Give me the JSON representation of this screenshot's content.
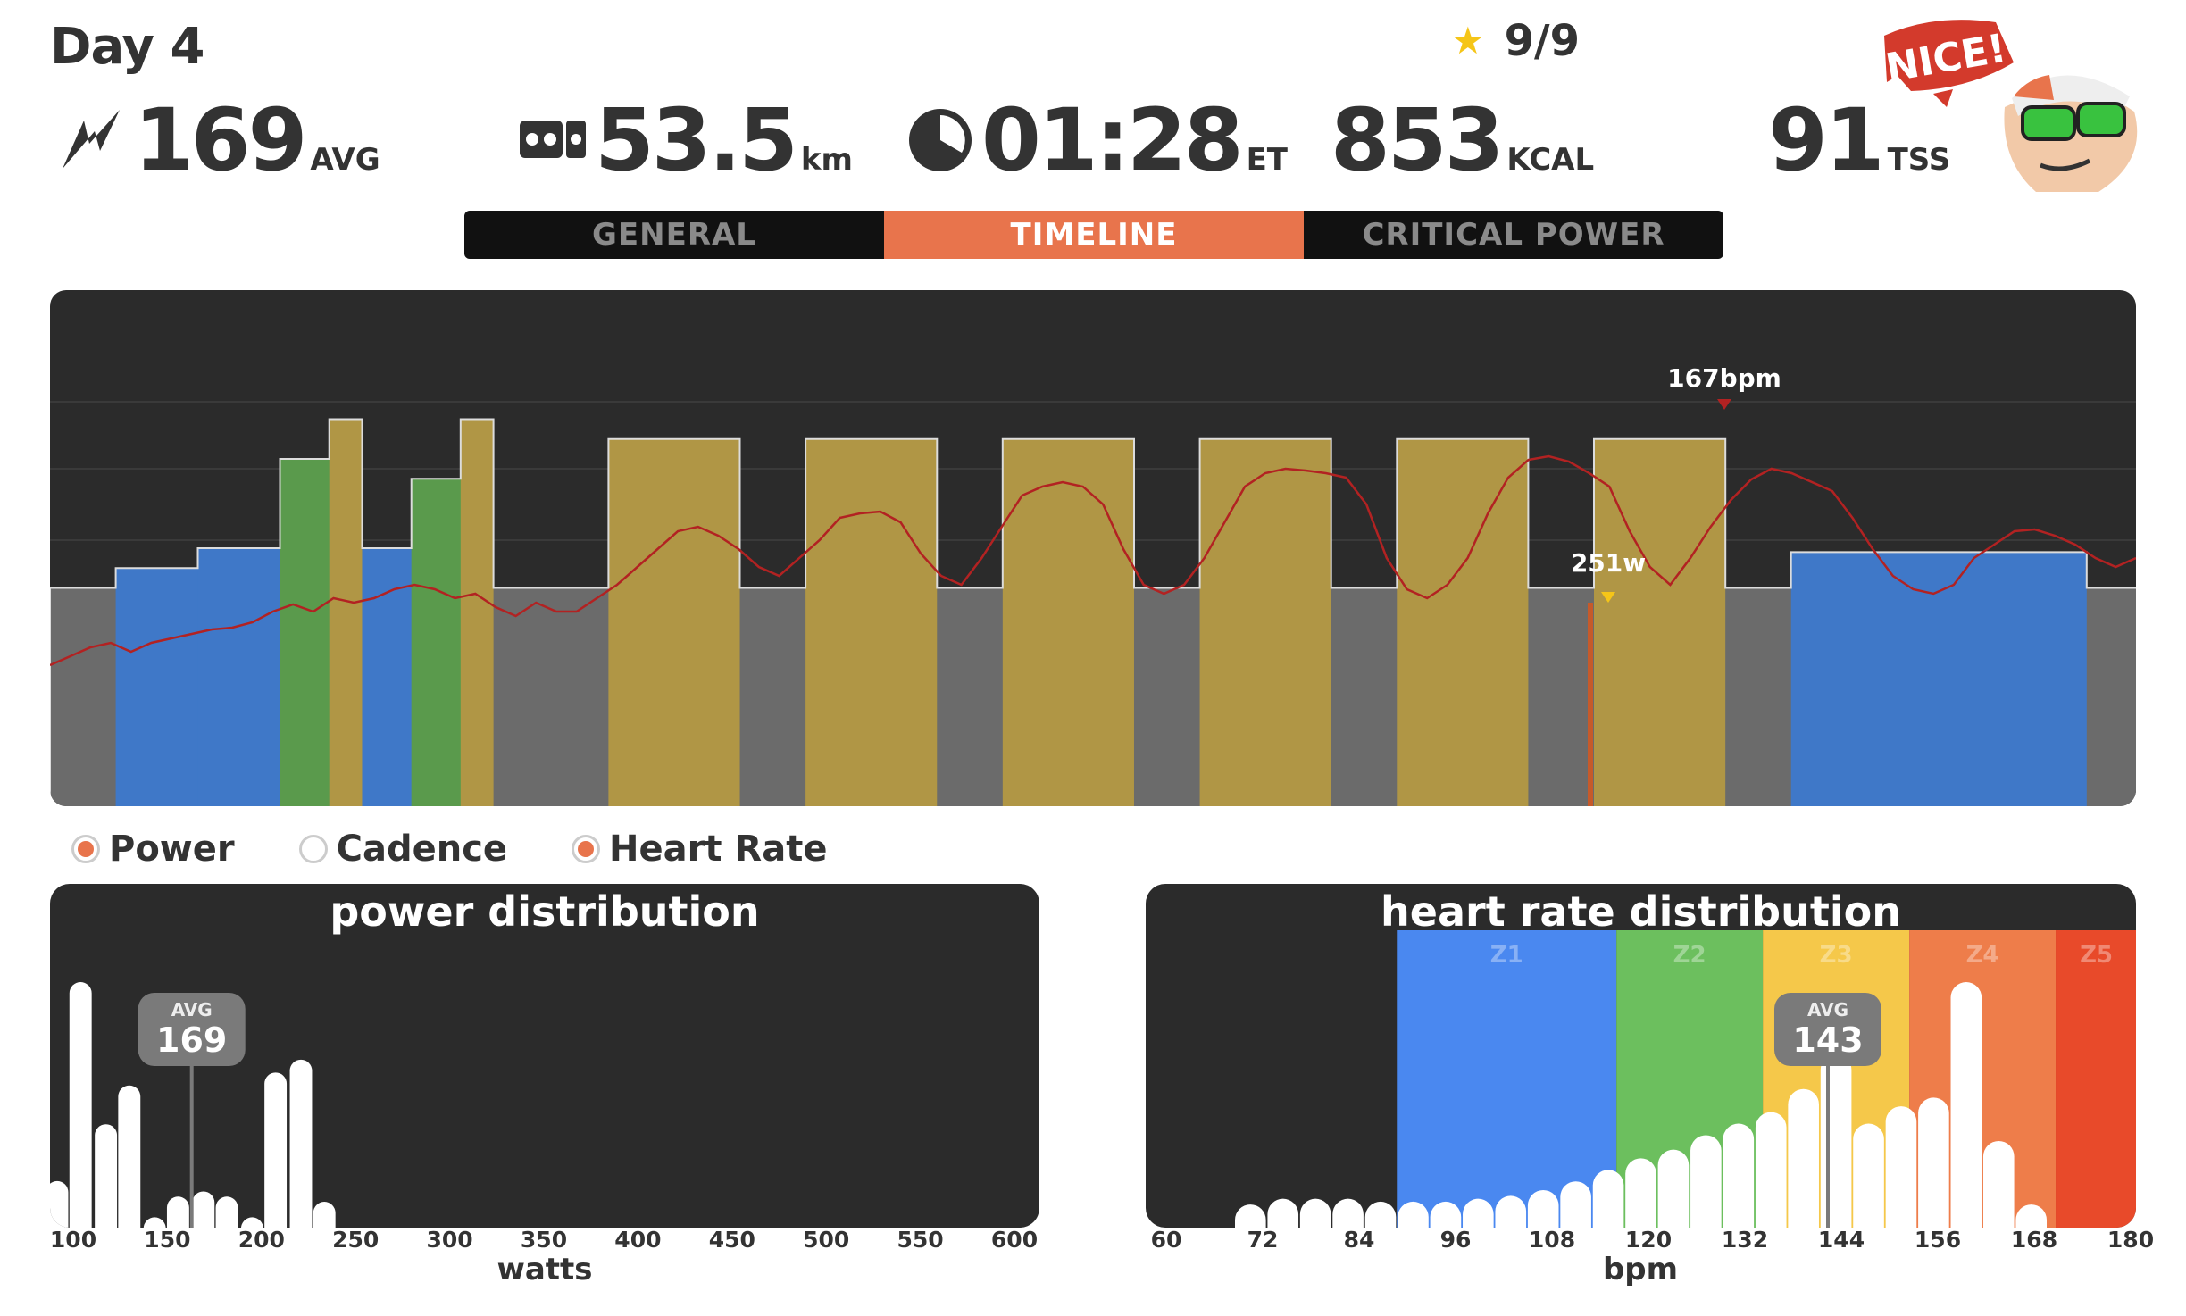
{
  "header": {
    "title": "Day 4",
    "stars": "9/9"
  },
  "stats": {
    "power": {
      "value": "169",
      "unit": "AVG"
    },
    "distance": {
      "value": "53.5",
      "unit": "km"
    },
    "time": {
      "value": "01:28",
      "unit": "ET"
    },
    "calories": {
      "value": "853",
      "unit": "KCAL"
    },
    "tss": {
      "value": "91",
      "unit": "TSS"
    }
  },
  "mascot": {
    "bubble_text": "NICE!"
  },
  "tabs": [
    {
      "label": "GENERAL",
      "active": false
    },
    {
      "label": "TIMELINE",
      "active": true
    },
    {
      "label": "CRITICAL POWER",
      "active": false
    }
  ],
  "timeline": {
    "max_hr_label": "167bpm",
    "max_power_label": "251w"
  },
  "toggles": [
    {
      "label": "Power",
      "on": true
    },
    {
      "label": "Cadence",
      "on": false
    },
    {
      "label": "Heart Rate",
      "on": true
    }
  ],
  "power_distribution": {
    "title": "power distribution",
    "avg_label": "AVG",
    "avg_value": "169",
    "x_ticks": [
      "100",
      "150",
      "200",
      "250",
      "300",
      "350",
      "400",
      "450",
      "500",
      "550",
      "600"
    ],
    "x_label": "watts"
  },
  "hr_distribution": {
    "title": "heart rate distribution",
    "avg_label": "AVG",
    "avg_value": "143",
    "zones": [
      "Z1",
      "Z2",
      "Z3",
      "Z4",
      "Z5"
    ],
    "x_ticks": [
      "60",
      "72",
      "84",
      "96",
      "108",
      "120",
      "132",
      "144",
      "156",
      "168",
      "180"
    ],
    "x_label": "bpm"
  },
  "colors": {
    "accent": "#e8744c",
    "panel": "#2b2b2b",
    "zone_gray": "#6b6b6b",
    "zone_blue": "#3f78c8",
    "zone_green": "#5a9a4c",
    "zone_yellow": "#b09645",
    "hr_line": "#b22222",
    "z1": "#4a88f0",
    "z2": "#6cbf5e",
    "z3": "#f5c84a",
    "z4": "#ee7d4a",
    "z5": "#e84a2a"
  },
  "chart_data": [
    {
      "type": "area",
      "name": "power timeline",
      "segments_zone": [
        "gray",
        "blue",
        "blue",
        "green",
        "yellow",
        "blue",
        "green",
        "yellow",
        "gray",
        "yellow",
        "gray",
        "yellow",
        "gray",
        "yellow",
        "gray",
        "yellow",
        "gray",
        "yellow",
        "gray",
        "yellow",
        "gray",
        "blue",
        "gray"
      ],
      "segments_power_w": [
        110,
        120,
        130,
        175,
        195,
        130,
        165,
        195,
        110,
        185,
        110,
        185,
        110,
        185,
        110,
        185,
        110,
        185,
        110,
        185,
        110,
        128,
        110
      ],
      "segments_len": [
        4,
        5,
        5,
        3,
        2,
        3,
        3,
        2,
        7,
        8,
        4,
        8,
        4,
        8,
        4,
        8,
        4,
        8,
        4,
        8,
        4,
        18,
        3
      ]
    },
    {
      "type": "bar",
      "name": "power distribution",
      "x": [
        100,
        112,
        125,
        137,
        150,
        162,
        175,
        187,
        200,
        212,
        225,
        237,
        250
      ],
      "values": [
        18,
        95,
        40,
        55,
        4,
        12,
        14,
        12,
        4,
        60,
        65,
        10,
        0
      ]
    },
    {
      "type": "bar",
      "name": "heart rate distribution",
      "x": [
        72,
        76,
        80,
        84,
        88,
        92,
        96,
        100,
        104,
        108,
        112,
        116,
        120,
        124,
        128,
        132,
        136,
        140,
        144,
        148,
        152,
        156,
        160,
        164,
        168
      ],
      "values": [
        8,
        10,
        10,
        10,
        9,
        9,
        9,
        10,
        11,
        13,
        16,
        20,
        24,
        27,
        32,
        36,
        40,
        48,
        60,
        36,
        42,
        45,
        85,
        30,
        8
      ]
    }
  ]
}
